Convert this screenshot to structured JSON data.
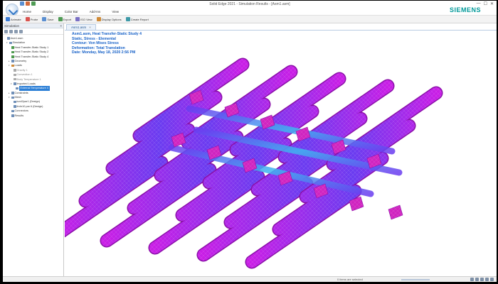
{
  "window": {
    "title": "Solid Edge 2021 - Simulation Results - [Asm1.asm]",
    "brand": "SIEMENS",
    "controls": [
      "—",
      "☐",
      "✕"
    ]
  },
  "ribbon": {
    "tabs": [
      {
        "label": "Home",
        "active": false
      },
      {
        "label": "Display",
        "active": false
      },
      {
        "label": "Color Bar",
        "active": false
      },
      {
        "label": "Add-Ins",
        "active": false
      },
      {
        "label": "View",
        "active": false
      }
    ],
    "commands": [
      {
        "label": "Animate",
        "color": "#3a7bd5"
      },
      {
        "label": "Probe",
        "color": "#d9534f"
      },
      {
        "label": "Save",
        "color": "#5b8fd1"
      },
      {
        "label": "Export",
        "color": "#4f9b54"
      },
      {
        "label": "ISO View",
        "color": "#7a6fc4"
      },
      {
        "label": "Display Options",
        "color": "#d08a35"
      },
      {
        "label": "Create Report",
        "color": "#3e9aa8"
      }
    ]
  },
  "panel": {
    "title": "Simulation",
    "close": "×",
    "tree": [
      {
        "label": "Asm1.asm",
        "indent": 0,
        "style": "",
        "exp": "",
        "selected": false
      },
      {
        "label": "Simulation",
        "indent": 1,
        "style": "",
        "exp": "▾",
        "selected": false
      },
      {
        "label": "Heat Transfer-Static Study 1",
        "indent": 2,
        "style": "green",
        "exp": "",
        "selected": false
      },
      {
        "label": "Heat Transfer-Static Study 2",
        "indent": 2,
        "style": "green",
        "exp": "",
        "selected": false
      },
      {
        "label": "Heat Transfer-Static Study 4",
        "indent": 2,
        "style": "green",
        "exp": "",
        "selected": false
      },
      {
        "label": "Geometry",
        "indent": 2,
        "style": "",
        "exp": "▸",
        "selected": false
      },
      {
        "label": "Loads",
        "indent": 2,
        "style": "orange",
        "exp": "▾",
        "selected": false
      },
      {
        "label": "Gravity 1",
        "indent": 3,
        "style": "grey",
        "exp": "",
        "selected": false
      },
      {
        "label": "Convection 1",
        "indent": 3,
        "style": "grey",
        "exp": "",
        "selected": false
      },
      {
        "label": "Body Temperature 1",
        "indent": 3,
        "style": "grey",
        "exp": "",
        "selected": false
      },
      {
        "label": "Imported Loads",
        "indent": 3,
        "style": "",
        "exp": "▾",
        "selected": false
      },
      {
        "label": "External Temperature 4",
        "indent": 4,
        "style": "",
        "exp": "",
        "selected": true
      },
      {
        "label": "Constraints",
        "indent": 2,
        "style": "",
        "exp": "▸",
        "selected": false
      },
      {
        "label": "Mesh",
        "indent": 2,
        "style": "",
        "exp": "▾",
        "selected": false
      },
      {
        "label": "tun42par1 (Design)",
        "indent": 3,
        "style": "",
        "exp": "",
        "selected": false
      },
      {
        "label": "fmhr10 par 6 (Design)",
        "indent": 3,
        "style": "",
        "exp": "",
        "selected": false
      },
      {
        "label": "Connectors",
        "indent": 2,
        "style": "",
        "exp": "",
        "selected": false
      },
      {
        "label": "Results",
        "indent": 2,
        "style": "",
        "exp": "",
        "selected": false
      }
    ]
  },
  "document": {
    "tab_label": "Asm1.asm",
    "tab_close": "×"
  },
  "results": {
    "lines": [
      "Asm1.asm, Heat Transfer-Static Study 4",
      "Static, Stress - Elemental",
      "Contour: Von Mises Stress",
      "Deformation: Total Translation",
      "Date: Monday, May 18, 2020  2:56 PM"
    ]
  },
  "model": {
    "tubes": 5,
    "colors": {
      "low": "#c81ee6",
      "mid": "#6a3cf0",
      "high": "#3fb6f0",
      "fin": "#d024c0",
      "edge": "#8a10a8"
    }
  },
  "status": {
    "message": "0 items are selected"
  }
}
